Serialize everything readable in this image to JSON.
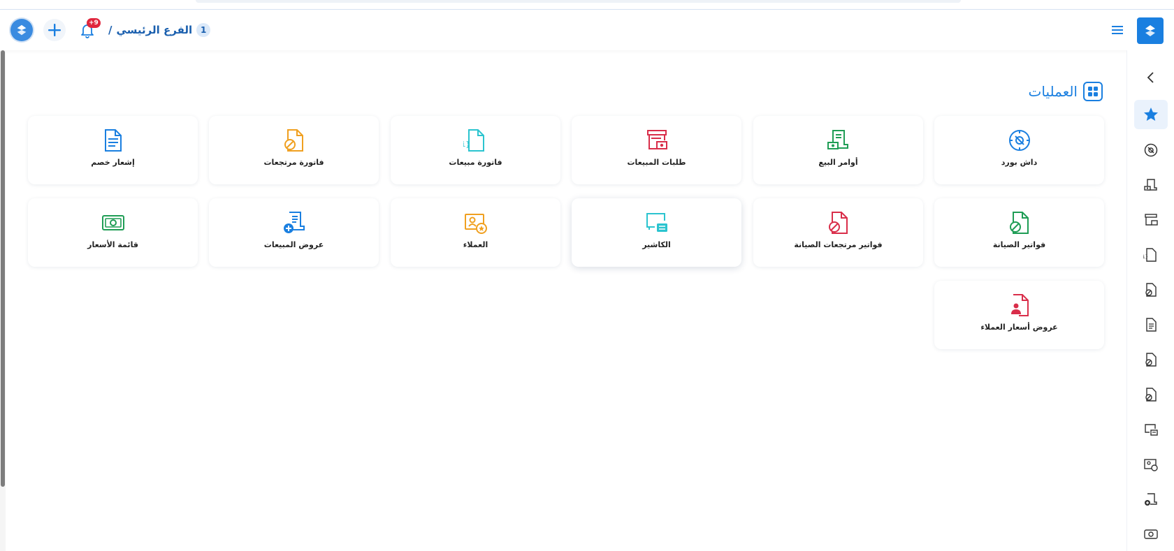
{
  "header": {
    "branch_number": "1",
    "branch_name": "الفرع الرئيسي",
    "branch_separator": "/",
    "notifications_badge": "+9"
  },
  "section": {
    "title": "العمليات"
  },
  "tiles": [
    {
      "label": "داش بورد",
      "icon": "dashboard-compass-icon",
      "color": "#1a7fe0"
    },
    {
      "label": "أوامر البيع",
      "icon": "sales-order-icon",
      "color": "#1f9d55"
    },
    {
      "label": "طلبات المبيعات",
      "icon": "sales-requests-icon",
      "color": "#d92e4a"
    },
    {
      "label": "فاتورة مبيعات",
      "icon": "sales-invoice-icon",
      "color": "#2bc4cf"
    },
    {
      "label": "فاتورة مرتجعات",
      "icon": "returns-invoice-icon",
      "color": "#f0a020"
    },
    {
      "label": "إشعار خصم",
      "icon": "discount-notice-icon",
      "color": "#1a7fe0"
    },
    {
      "label": "فواتير الصيانة",
      "icon": "maintenance-invoice-icon",
      "color": "#1f9d55"
    },
    {
      "label": "فواتير مرتجعات الصيانة",
      "icon": "maintenance-returns-icon",
      "color": "#d92e4a"
    },
    {
      "label": "الكاشير",
      "icon": "cashier-icon",
      "color": "#2bc4cf"
    },
    {
      "label": "العملاء",
      "icon": "customers-icon",
      "color": "#f0a020"
    },
    {
      "label": "عروض المبيعات",
      "icon": "sales-offers-icon",
      "color": "#1a7fe0"
    },
    {
      "label": "قائمة الأسعار",
      "icon": "price-list-icon",
      "color": "#1f9d55"
    },
    {
      "label": "عروض أسعار العملاء",
      "icon": "customer-quotes-icon",
      "color": "#d92e4a"
    }
  ],
  "colors": {
    "primary": "#1a7fe0",
    "badge": "#e0263d"
  }
}
